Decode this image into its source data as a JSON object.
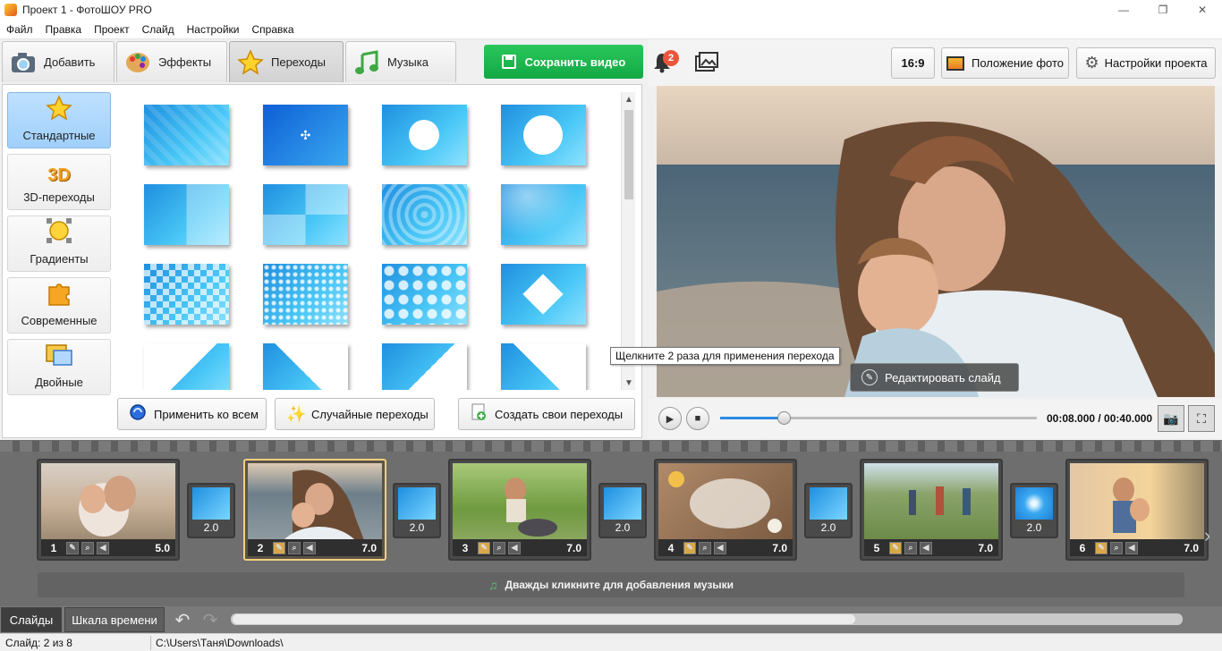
{
  "window": {
    "title": "Проект 1 - ФотоШОУ PRO",
    "controls": [
      "—",
      "❐",
      "✕"
    ]
  },
  "menu": [
    "Файл",
    "Правка",
    "Проект",
    "Слайд",
    "Настройки",
    "Справка"
  ],
  "tabs": [
    {
      "label": "Добавить",
      "icon": "camera-icon"
    },
    {
      "label": "Эффекты",
      "icon": "palette-icon"
    },
    {
      "label": "Переходы",
      "icon": "star-icon",
      "active": true
    },
    {
      "label": "Музыка",
      "icon": "music-note-icon"
    }
  ],
  "save_button": "Сохранить видео",
  "notifications": {
    "count": "2"
  },
  "aspect_button": "16:9",
  "photo_position_button": "Положение фото",
  "project_settings_button": "Настройки проекта",
  "categories": [
    {
      "label": "Стандартные",
      "icon": "star-icon",
      "active": true
    },
    {
      "label": "3D-переходы",
      "icon": "3d-icon",
      "badge": "3D"
    },
    {
      "label": "Градиенты",
      "icon": "sun-icon"
    },
    {
      "label": "Современные",
      "icon": "puzzle-icon"
    },
    {
      "label": "Двойные",
      "icon": "double-frame-icon"
    }
  ],
  "bottom_buttons": {
    "apply_all": "Применить ко всем",
    "random": "Случайные переходы",
    "create": "Создать свои переходы"
  },
  "tooltip": "Щелкните 2 раза для применения перехода",
  "edit_slide_button": "Редактировать слайд",
  "player": {
    "time": "00:08.000 / 00:40.000",
    "progress": 0.2
  },
  "slides": [
    {
      "num": "1",
      "duration": "5.0"
    },
    {
      "num": "2",
      "duration": "7.0",
      "active": true
    },
    {
      "num": "3",
      "duration": "7.0"
    },
    {
      "num": "4",
      "duration": "7.0"
    },
    {
      "num": "5",
      "duration": "7.0"
    },
    {
      "num": "6",
      "duration": "7.0"
    }
  ],
  "transitions": [
    "2.0",
    "2.0",
    "2.0",
    "2.0",
    "2.0"
  ],
  "music_hint": "Дважды кликните для добавления музыки",
  "bottom_tabs": {
    "slides": "Слайды",
    "timeline": "Шкала времени"
  },
  "status": {
    "slide": "Слайд: 2 из 8",
    "path": "C:\\Users\\Таня\\Downloads\\"
  }
}
